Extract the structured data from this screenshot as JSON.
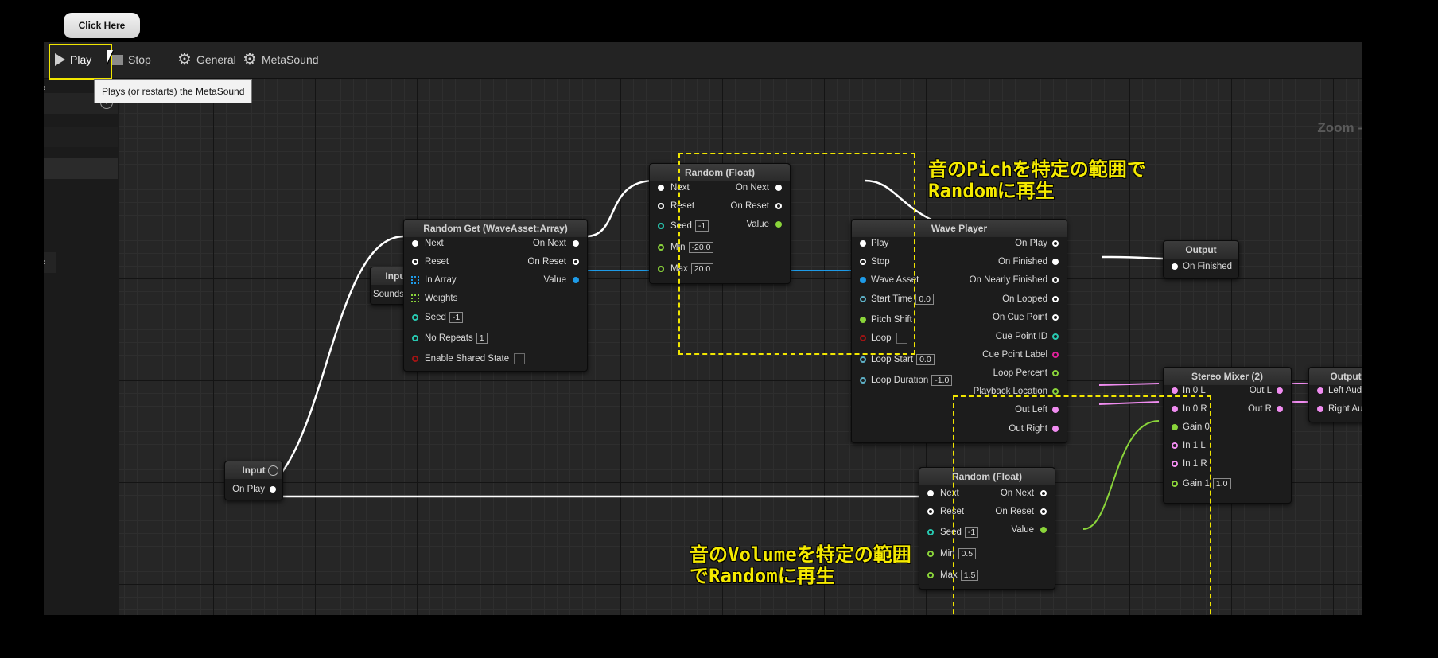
{
  "toolbar": {
    "play_label": "Play",
    "stop_label": "Stop",
    "general_label": "General",
    "metasound_label": "MetaSound"
  },
  "callout": {
    "text": "Click Here"
  },
  "tooltip": {
    "text": "Plays (or restarts) the MetaSound"
  },
  "canvas": {
    "zoom_label": "Zoom -"
  },
  "nodes": {
    "input_sounds": {
      "title": "Input",
      "out": "Sounds"
    },
    "input_onplay": {
      "title": "Input",
      "out": "On Play"
    },
    "random_get": {
      "title": "Random Get (WaveAsset:Array)",
      "in_next": "Next",
      "in_reset": "Reset",
      "in_array": "In Array",
      "in_weights": "Weights",
      "in_seed": "Seed",
      "seed_value": "-1",
      "in_norepeats": "No Repeats",
      "norepeats_value": "1",
      "in_shared": "Enable Shared State",
      "out_next": "On Next",
      "out_reset": "On Reset",
      "out_value": "Value"
    },
    "random_float_pitch": {
      "title": "Random (Float)",
      "in_next": "Next",
      "in_reset": "Reset",
      "in_seed": "Seed",
      "seed_value": "-1",
      "in_min": "Min",
      "min_value": "-20.0",
      "in_max": "Max",
      "max_value": "20.0",
      "out_next": "On Next",
      "out_reset": "On Reset",
      "out_value": "Value"
    },
    "wave_player": {
      "title": "Wave Player",
      "in_play": "Play",
      "in_stop": "Stop",
      "in_wave": "Wave Asset",
      "in_start": "Start Time",
      "start_value": "0.0",
      "in_pitch": "Pitch Shift",
      "in_loop": "Loop",
      "in_loopstart": "Loop Start",
      "loopstart_value": "0.0",
      "in_loopdur": "Loop Duration",
      "loopdur_value": "-1.0",
      "out_onplay": "On Play",
      "out_finished": "On Finished",
      "out_nearly": "On Nearly Finished",
      "out_looped": "On Looped",
      "out_cue": "On Cue Point",
      "out_cueid": "Cue Point ID",
      "out_cuelabel": "Cue Point Label",
      "out_looppct": "Loop Percent",
      "out_playloc": "Playback Location",
      "out_left": "Out Left",
      "out_right": "Out Right"
    },
    "output_finished": {
      "title": "Output",
      "in": "On Finished"
    },
    "stereo_mixer": {
      "title": "Stereo Mixer (2)",
      "in_0l": "In 0 L",
      "in_0r": "In 0 R",
      "in_gain0": "Gain 0",
      "in_1l": "In 1 L",
      "in_1r": "In 1 R",
      "in_gain1": "Gain 1",
      "gain1_value": "1.0",
      "out_l": "Out L",
      "out_r": "Out R"
    },
    "output_audio": {
      "title": "Output",
      "in_left": "Left Audio",
      "in_right": "Right Audio"
    },
    "random_float_volume": {
      "title": "Random (Float)",
      "in_next": "Next",
      "in_reset": "Reset",
      "in_seed": "Seed",
      "seed_value": "-1",
      "in_min": "Min",
      "min_value": "0.5",
      "in_max": "Max",
      "max_value": "1.5",
      "out_next": "On Next",
      "out_reset": "On Reset",
      "out_value": "Value"
    }
  },
  "annotations": {
    "pitch_line1": "音のPichを特定の範囲で",
    "pitch_line2": "Randomに再生",
    "volume_line1": "音のVolumeを特定の範囲",
    "volume_line2": "でRandomに再生"
  },
  "colors": {
    "exec": "#ffffff",
    "audio": "#f08cf0",
    "float": "#8ad43a",
    "wave": "#1e9be8",
    "int": "#28c8b0",
    "bool": "#a01414",
    "annotation": "#f5ea00"
  }
}
